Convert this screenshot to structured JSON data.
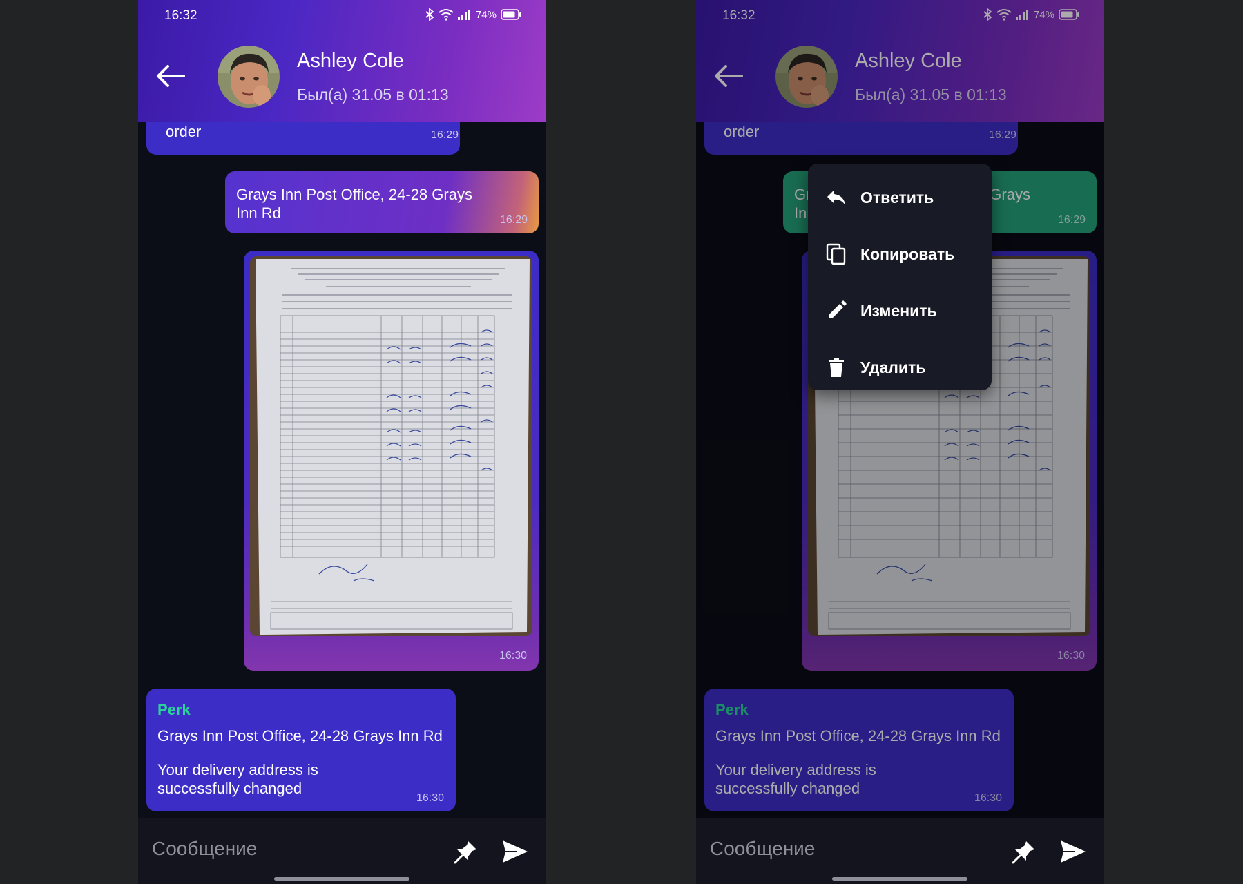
{
  "status_bar": {
    "time": "16:32",
    "battery": "74%"
  },
  "header": {
    "contact_name": "Ashley Cole",
    "last_seen": "Был(а) 31.05 в 01:13"
  },
  "messages": {
    "order": {
      "text": "order",
      "time": "16:29"
    },
    "address": {
      "text": "Grays Inn Post Office, 24-28 Grays Inn Rd",
      "time": "16:29"
    },
    "photo": {
      "time": "16:30"
    },
    "perk": {
      "sender": "Perk",
      "quoted": "Grays Inn Post Office, 24-28 Grays Inn Rd",
      "text": "Your delivery address is successfully changed",
      "time": "16:30"
    }
  },
  "input": {
    "placeholder": "Сообщение"
  },
  "context_menu": {
    "items": [
      {
        "label": "Ответить",
        "icon": "reply-icon"
      },
      {
        "label": "Копировать",
        "icon": "copy-icon"
      },
      {
        "label": "Изменить",
        "icon": "edit-icon"
      },
      {
        "label": "Удалить",
        "icon": "delete-icon"
      }
    ]
  },
  "colors": {
    "header_gradient_start": "#3c1aa7",
    "header_gradient_end": "#9d3cc7",
    "incoming_bubble": "#3c2dc6",
    "selected_bubble": "#25a27a",
    "sender_name": "#2bd39a",
    "background": "#0b0d17"
  }
}
